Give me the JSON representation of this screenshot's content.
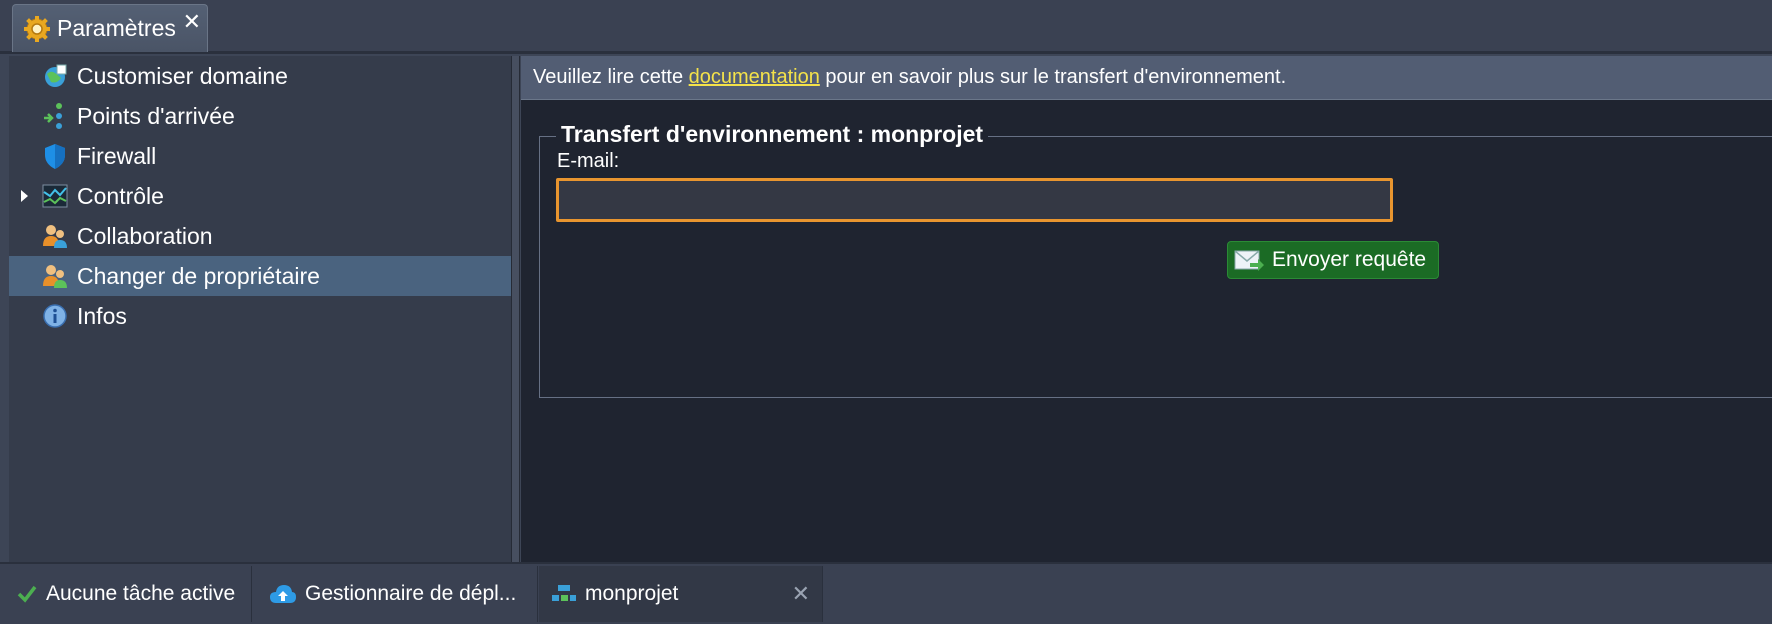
{
  "tab": {
    "label": "Paramètres",
    "icon": "gear-icon",
    "close": "✕"
  },
  "sidebar": {
    "items": [
      {
        "label": "Customiser domaine",
        "icon": "globe-icon"
      },
      {
        "label": "Points d'arrivée",
        "icon": "endpoints-icon"
      },
      {
        "label": "Firewall",
        "icon": "shield-icon"
      },
      {
        "label": "Contrôle",
        "icon": "monitoring-chart-icon",
        "expandable": true
      },
      {
        "label": "Collaboration",
        "icon": "users-icon"
      },
      {
        "label": "Changer de propriétaire",
        "icon": "change-owner-icon",
        "selected": true
      },
      {
        "label": "Infos",
        "icon": "info-icon"
      }
    ]
  },
  "main": {
    "info": {
      "before": "Veuillez lire cette ",
      "link": "documentation",
      "after": " pour en savoir plus sur le transfert d'environnement."
    },
    "legend": "Transfert d'environnement : monprojet",
    "email_label": "E-mail:",
    "email_value": "",
    "send_button": "Envoyer requête"
  },
  "taskbar": {
    "items": [
      {
        "label": "Aucune tâche active",
        "icon": "checkmark-icon"
      },
      {
        "label": "Gestionnaire de dépl...",
        "icon": "cloud-upload-icon"
      },
      {
        "label": "monprojet",
        "icon": "environment-icon",
        "close": "✕"
      }
    ]
  },
  "colors": {
    "accent_input_border": "#e8952f",
    "link": "#f4e24a",
    "send_button": "#1b6b25",
    "selected_item": "#4a637f"
  }
}
